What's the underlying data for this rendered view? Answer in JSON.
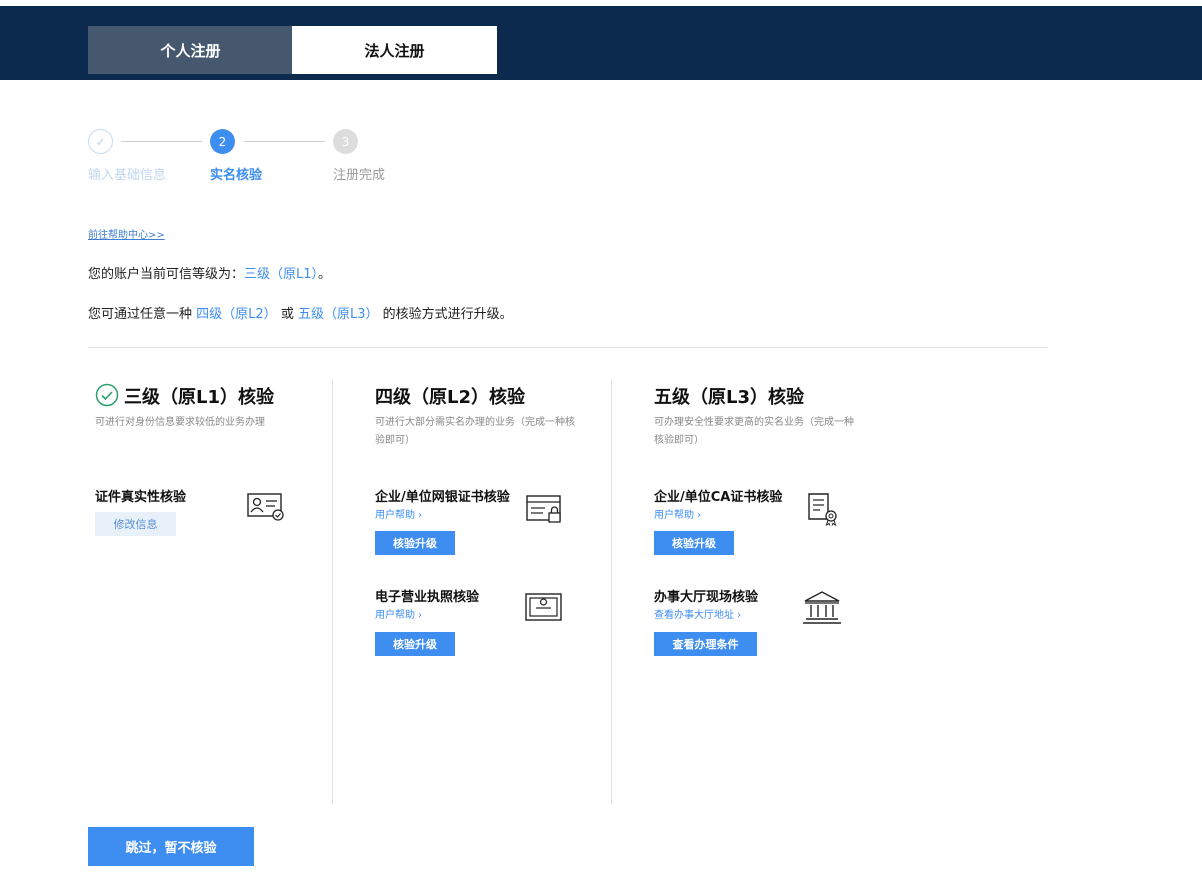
{
  "tabs": {
    "personal": "个人注册",
    "corporate": "法人注册"
  },
  "steps": {
    "step1_label": "输入基础信息",
    "step2_number": "2",
    "step2_label": "实名核验",
    "step3_number": "3",
    "step3_label": "注册完成"
  },
  "help_link": "前往帮助中心>>",
  "trust_level": {
    "prefix": "您的账户当前可信等级为：",
    "level": "三级（原L1）",
    "suffix": "。"
  },
  "upgrade_info": {
    "prefix": "您可通过任意一种",
    "option1": "四级（原L2）",
    "or": "或",
    "option2": "五级（原L3）",
    "suffix": "的核验方式进行升级。"
  },
  "columns": {
    "level3": {
      "title": "三级（原L1）核验",
      "desc": "可进行对身份信息要求较低的业务办理",
      "items": [
        {
          "title": "证件真实性核验",
          "button": "修改信息"
        }
      ]
    },
    "level4": {
      "title": "四级（原L2）核验",
      "desc": "可进行大部分需实名办理的业务（完成一种核验即可）",
      "items": [
        {
          "title": "企业/单位网银证书核验",
          "link": "用户帮助 ›",
          "button": "核验升级"
        },
        {
          "title": "电子营业执照核验",
          "link": "用户帮助 ›",
          "button": "核验升级"
        }
      ]
    },
    "level5": {
      "title": "五级（原L3）核验",
      "desc": "可办理安全性要求更高的实名业务（完成一种核验即可）",
      "items": [
        {
          "title": "企业/单位CA证书核验",
          "link": "用户帮助 ›",
          "button": "核验升级"
        },
        {
          "title": "办事大厅现场核验",
          "link": "查看办事大厅地址 ›",
          "button": "查看办理条件"
        }
      ]
    }
  },
  "skip_button": "跳过，暂不核验",
  "colors": {
    "header_bg": "#0b2a4d",
    "accent": "#3d8ef0",
    "inactive_tab": "#46586e"
  },
  "icons": {
    "step1": "check-icon",
    "level3_status": "check-circle-icon",
    "id_card": "id-card-icon",
    "bank_cert": "bank-certificate-icon",
    "license": "e-license-icon",
    "ca_cert": "ca-certificate-icon",
    "hall": "government-building-icon"
  }
}
